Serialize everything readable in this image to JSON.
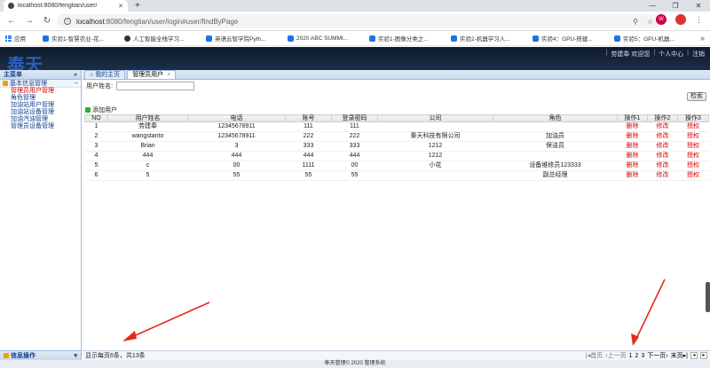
{
  "browser": {
    "tab_title": "localhost:8080/fengtian/user/",
    "new_tab": "+",
    "window_controls": [
      "—",
      "❐",
      "✕"
    ],
    "url_host": "localhost",
    "url_path": ":8080/fengtian/user/login#user/findByPage",
    "avatar_letter": "W"
  },
  "bookmarks": [
    {
      "label": "应用",
      "icon": "apps-grid-icon"
    },
    {
      "label": "实验1-智慧农业-花...",
      "icon": "wifi-icon"
    },
    {
      "label": "人工智能全栈学习...",
      "icon": "github-icon"
    },
    {
      "label": "英语云智学院Pyth...",
      "icon": "wifi-icon"
    },
    {
      "label": "2020 ABC SUMMI...",
      "icon": "wifi-icon"
    },
    {
      "label": "实验1-图像分类之...",
      "icon": "wifi-icon"
    },
    {
      "label": "实验2-机器学习人...",
      "icon": "wifi-icon"
    },
    {
      "label": "实验4：GPU-搭建...",
      "icon": "wifi-icon"
    },
    {
      "label": "实验5：GPU-机器...",
      "icon": "wifi-icon"
    }
  ],
  "app": {
    "logo": "奉天",
    "user_nav": [
      "劳建奉 欢迎您",
      "个人中心",
      "注销"
    ]
  },
  "sidebar": {
    "header": "主菜单",
    "collapse": "«",
    "group_title": "基本信息管理",
    "group_toggle": "−",
    "items": [
      "管理员用户管理",
      "角色管理",
      "加油站用户管理",
      "加油站设备管理",
      "加油汽油管理",
      "管理员设备管理"
    ],
    "footer": "信息操作",
    "footer_toggle": "▾"
  },
  "main": {
    "tabs": [
      {
        "label": "我的主页"
      },
      {
        "label": "管理员用户",
        "close": "×"
      }
    ],
    "search_label": "用户姓名:",
    "search_button": "检索",
    "add_button": "添加用户",
    "columns": [
      "NO",
      "用户姓名",
      "电话",
      "账号",
      "登录密码",
      "公司",
      "角色",
      "操作1",
      "操作2",
      "操作3"
    ],
    "rows": [
      [
        "1",
        "劳建奉",
        "12345678911",
        "111",
        "111",
        "",
        "",
        "删除",
        "修改",
        "授权"
      ],
      [
        "2",
        "wangstanto",
        "12345678911",
        "222",
        "222",
        "秦天科技有限公司",
        "加油员",
        "删除",
        "修改",
        "授权"
      ],
      [
        "3",
        "Brian",
        "3",
        "333",
        "333",
        "1212",
        "保洁员",
        "删除",
        "修改",
        "授权"
      ],
      [
        "4",
        "444",
        "444",
        "444",
        "444",
        "1212",
        "",
        "删除",
        "修改",
        "授权"
      ],
      [
        "5",
        "c",
        "00",
        "1111",
        "00",
        "小花",
        "设备维修员123333",
        "删除",
        "修改",
        "授权"
      ],
      [
        "6",
        "5",
        "55",
        "55",
        "55",
        "",
        "副总经理",
        "删除",
        "修改",
        "授权"
      ]
    ],
    "page_info": "显示每页6条，共13条",
    "pager": {
      "first": "首页",
      "prev": "上一页",
      "pages": [
        "1",
        "2",
        "3"
      ],
      "next": "下一页",
      "last": "末页"
    }
  },
  "footer_text": "奉天管理© 2020 管理系统",
  "colors": {
    "header_bg": "#1c2e48",
    "logo": "#2a5fb4",
    "action_red": "#dd0000",
    "annotation_arrow": "#e52a1e"
  }
}
